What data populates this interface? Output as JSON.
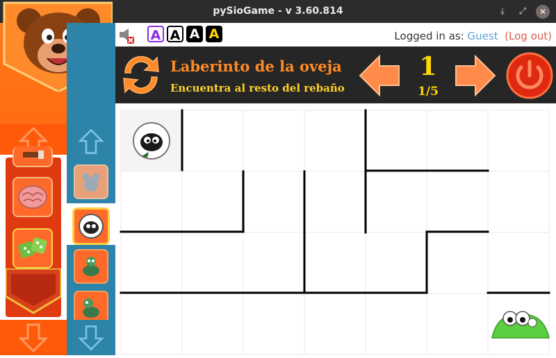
{
  "window": {
    "title": "pySioGame - v 3.60.814",
    "buttons": {
      "minimize": "⤓",
      "maximize": "⤢",
      "close": "✕"
    }
  },
  "topbar": {
    "font_buttons": [
      "A",
      "A",
      "A",
      "A"
    ],
    "login_prefix": "Logged in as:",
    "user": "Guest",
    "logout": "(Log out)"
  },
  "game": {
    "title": "Laberinto de la oveja",
    "subtitle": "Encuentra al resto del rebaño",
    "level": "1",
    "level_count": "1/5"
  },
  "colors": {
    "accent_orange": "#ff5a0a",
    "side_blue": "#2e84a8",
    "header_bg": "#262626",
    "title_orange": "#ff8a24",
    "subtitle_yellow": "#ffd22a"
  },
  "sidebar": {
    "categories": [
      "paint-category-icon",
      "brain-category-icon",
      "dice-category-icon"
    ],
    "games": [
      "mouse-game-icon",
      "sheep-game-icon",
      "turtle-game-icon",
      "turtle2-game-icon"
    ]
  },
  "maze": {
    "cols": 7,
    "rows": 4,
    "player": "sheep",
    "goal": "flock"
  }
}
